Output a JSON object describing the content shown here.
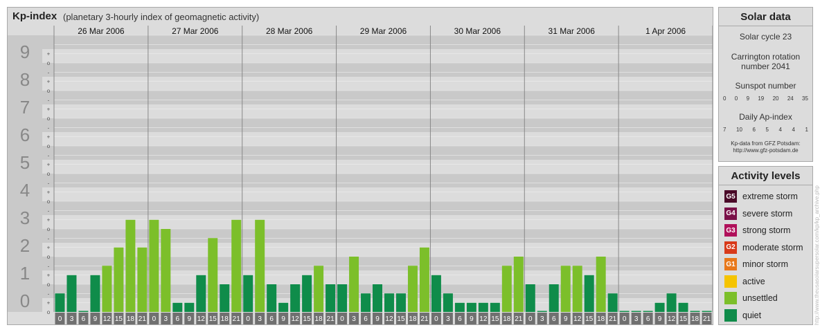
{
  "header": {
    "title": "Kp-index",
    "subtitle": "(planetary 3-hourly index of geomagnetic activity)"
  },
  "chart_data": {
    "type": "bar",
    "ylim": [
      0,
      9
    ],
    "y_ticks": [
      "0",
      "1",
      "2",
      "3",
      "4",
      "5",
      "6",
      "7",
      "8",
      "9"
    ],
    "y_sub_ticks": [
      "+",
      "o",
      "-"
    ],
    "days": [
      "26 Mar 2006",
      "27 Mar 2006",
      "28 Mar 2006",
      "29 Mar 2006",
      "30 Mar 2006",
      "31 Mar 2006",
      "1 Apr 2006"
    ],
    "interval_start": [
      "0",
      "3",
      "6",
      "9",
      "12",
      "15",
      "18",
      "21"
    ],
    "interval_end": [
      "3",
      "6",
      "9",
      "12",
      "15",
      "18",
      "21",
      "24"
    ],
    "values": [
      0.67,
      1.33,
      0,
      1.33,
      1.67,
      2.33,
      3.33,
      2.33,
      3.33,
      3,
      0.33,
      0.33,
      1.33,
      2.67,
      1,
      3.33,
      1.33,
      3.33,
      1,
      0.33,
      1,
      1.33,
      1.67,
      1,
      1,
      2,
      0.67,
      1,
      0.67,
      0.67,
      1.67,
      2.33,
      1.33,
      0.67,
      0.33,
      0.33,
      0.33,
      0.33,
      1.67,
      2,
      1,
      0,
      1,
      1.67,
      1.67,
      1.33,
      2,
      0.67,
      0,
      0,
      0,
      0.33,
      0.67,
      0.33,
      0,
      0
    ],
    "colors": {
      "quiet": "#0f8c4a",
      "unsettled": "#7cbf2a",
      "active": "#f5c400",
      "band_dark": "#c9c9c9",
      "band_light": "#dcdcdc",
      "grid": "#ededed",
      "axis_text": "#888888",
      "label_box": "#707070"
    }
  },
  "solar": {
    "title": "Solar data",
    "cycle": "Solar cycle 23",
    "carrington_line1": "Carrington rotation",
    "carrington_line2": "number 2041",
    "sunspot_label": "Sunspot number",
    "sunspot_values": [
      "0",
      "0",
      "9",
      "19",
      "20",
      "24",
      "35"
    ],
    "ap_label": "Daily Ap-index",
    "ap_values": [
      "7",
      "10",
      "6",
      "5",
      "4",
      "4",
      "1"
    ],
    "source_line1": "Kp-data from GFZ Potsdam:",
    "source_line2": "http://www.gfz-potsdam.de"
  },
  "activity": {
    "title": "Activity levels",
    "levels": [
      {
        "code": "G5",
        "label": "extreme storm",
        "color": "#4a0a28"
      },
      {
        "code": "G4",
        "label": "severe storm",
        "color": "#7a1048"
      },
      {
        "code": "G3",
        "label": "strong storm",
        "color": "#b0105a"
      },
      {
        "code": "G2",
        "label": "moderate storm",
        "color": "#d83a1a"
      },
      {
        "code": "G1",
        "label": "minor storm",
        "color": "#e8781a"
      },
      {
        "code": "",
        "label": "active",
        "color": "#f5c400"
      },
      {
        "code": "",
        "label": "unsettled",
        "color": "#7cbf2a"
      },
      {
        "code": "",
        "label": "quiet",
        "color": "#0f8c4a"
      }
    ]
  },
  "watermark": "http://www.theusasolarsupersolar.com/kp/kp_archive.php"
}
